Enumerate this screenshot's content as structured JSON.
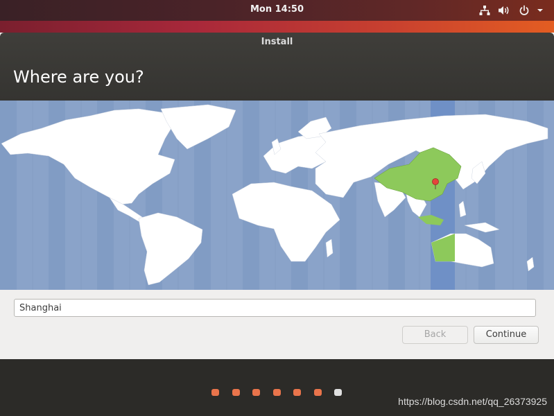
{
  "top_panel": {
    "clock": "Mon 14:50",
    "tray_icons": [
      "network-icon",
      "volume-icon",
      "power-icon",
      "chevron-down-icon"
    ]
  },
  "window": {
    "title": "Install",
    "heading": "Where are you?"
  },
  "map": {
    "selected_region": "China",
    "selected_city": "Shanghai",
    "highlight_color": "#8dc95b",
    "ocean_color": "#8aa3c9",
    "timezone_band_color": "#6f90c6"
  },
  "location_field": {
    "value": "Shanghai"
  },
  "buttons": {
    "back_label": "Back",
    "back_enabled": false,
    "continue_label": "Continue"
  },
  "progress": {
    "total_steps": 7,
    "current_step": 7,
    "accent_color": "#e9744b"
  },
  "watermark": "https://blog.csdn.net/qq_26373925"
}
